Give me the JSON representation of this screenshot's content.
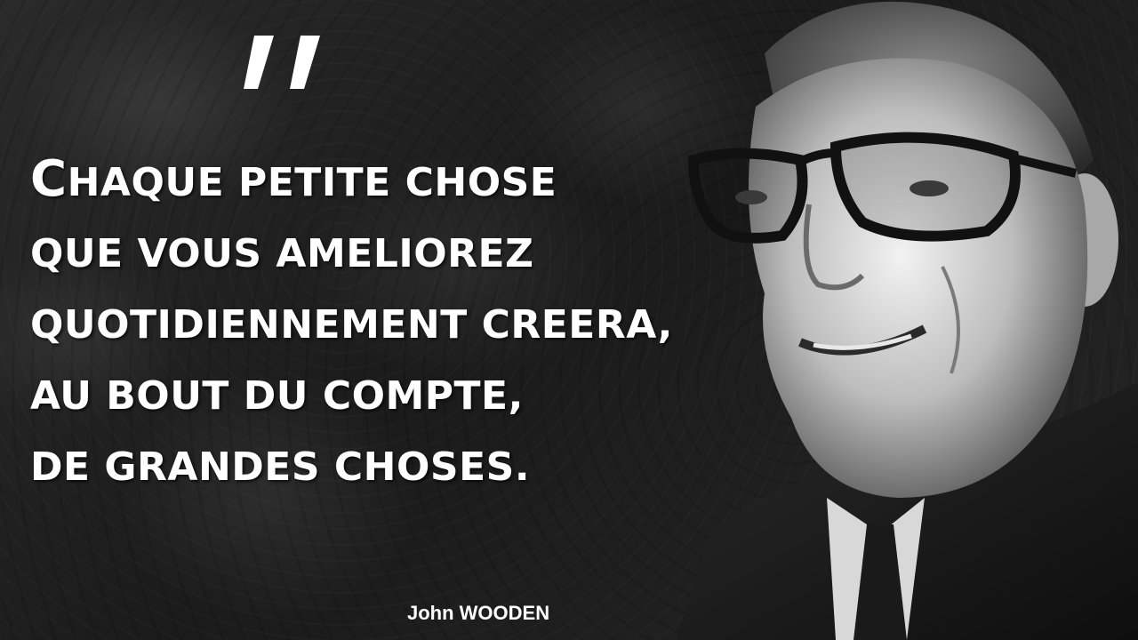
{
  "quote": {
    "lines": [
      "Chaque petite chose",
      "que vous ameliorez",
      "quotidiennement creera,",
      "au bout du compte,",
      "de grandes choses."
    ],
    "first_letter": "C",
    "first_line_rest": "haque petite chose"
  },
  "author": "John WOODEN",
  "portrait_icon": "person-portrait",
  "quote_mark_icon": "opening-quotation-mark",
  "colors": {
    "text": "#ffffff",
    "background": "#1f1f1f"
  }
}
